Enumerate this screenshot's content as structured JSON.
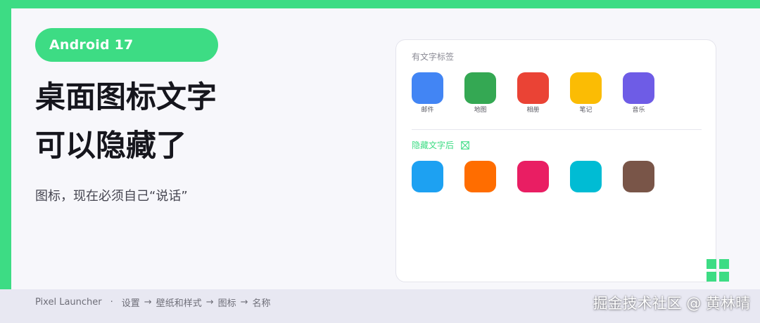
{
  "colors": {
    "accent": "#3ddc84",
    "background": "#f7f7fb",
    "headline": "#16161d",
    "footer": "#e8e8f2"
  },
  "header": {
    "badge": "Android 17",
    "headline_line1": "桌面图标文字",
    "headline_line2": "可以隐藏了",
    "subtitle": "图标，现在必须自己“说话”"
  },
  "card": {
    "with_labels": {
      "title": "有文字标签",
      "apps": [
        {
          "label": "邮件",
          "color": "#4285f4"
        },
        {
          "label": "地图",
          "color": "#34a853"
        },
        {
          "label": "相册",
          "color": "#ea4335"
        },
        {
          "label": "笔记",
          "color": "#fbbc04"
        },
        {
          "label": "音乐",
          "color": "#6e5ce6"
        }
      ]
    },
    "without_labels": {
      "title": "隐藏文字后",
      "icon": "hidden-text-icon",
      "apps": [
        {
          "color": "#1da1f2"
        },
        {
          "color": "#ff6d00"
        },
        {
          "color": "#e91e63"
        },
        {
          "color": "#00bcd4"
        },
        {
          "color": "#795548"
        }
      ]
    }
  },
  "logo_icon": "grid-icon",
  "footer": {
    "app": "Pixel Launcher",
    "separator": "·",
    "arrow": "→",
    "path": [
      "设置",
      "壁纸和样式",
      "图标",
      "名称"
    ],
    "watermark": "掘金技术社区 @ 黄林晴"
  }
}
